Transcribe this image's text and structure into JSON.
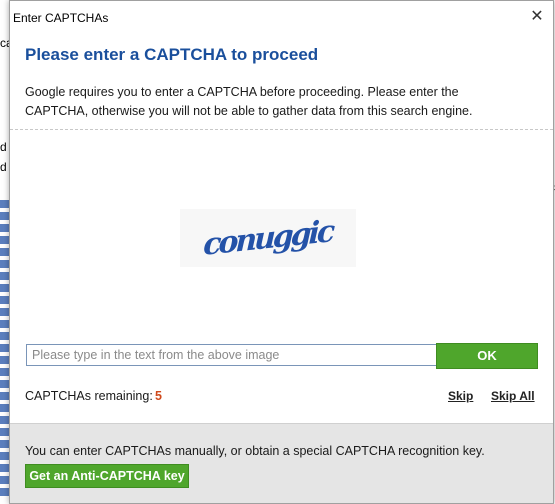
{
  "background": {
    "fragments": [
      "ca",
      "d",
      "d"
    ],
    "right_fragment": "ic"
  },
  "dialog": {
    "title": "Enter CAPTCHAs",
    "close_symbol": "✕",
    "heading": "Please enter a CAPTCHA to proceed",
    "description": "Google requires you to enter a CAPTCHA before proceeding. Please enter the CAPTCHA, otherwise you will not be able to gather data from this search engine.",
    "captcha_text": "conuggic",
    "input": {
      "value": "",
      "placeholder": "Please type in the text from the above image"
    },
    "ok_label": "OK",
    "remaining_label": "CAPTCHAs remaining:",
    "remaining_count": "5",
    "skip_label": "Skip",
    "skip_all_label": "Skip All",
    "footer_text": "You can enter CAPTCHAs manually, or obtain a special CAPTCHA recognition key.",
    "anticaptcha_label": "Get an Anti-CAPTCHA key"
  },
  "colors": {
    "heading": "#1a4f9c",
    "button_green": "#4fa62c",
    "count_orange": "#d04a1c",
    "footer_bg": "#e5e5e5"
  }
}
